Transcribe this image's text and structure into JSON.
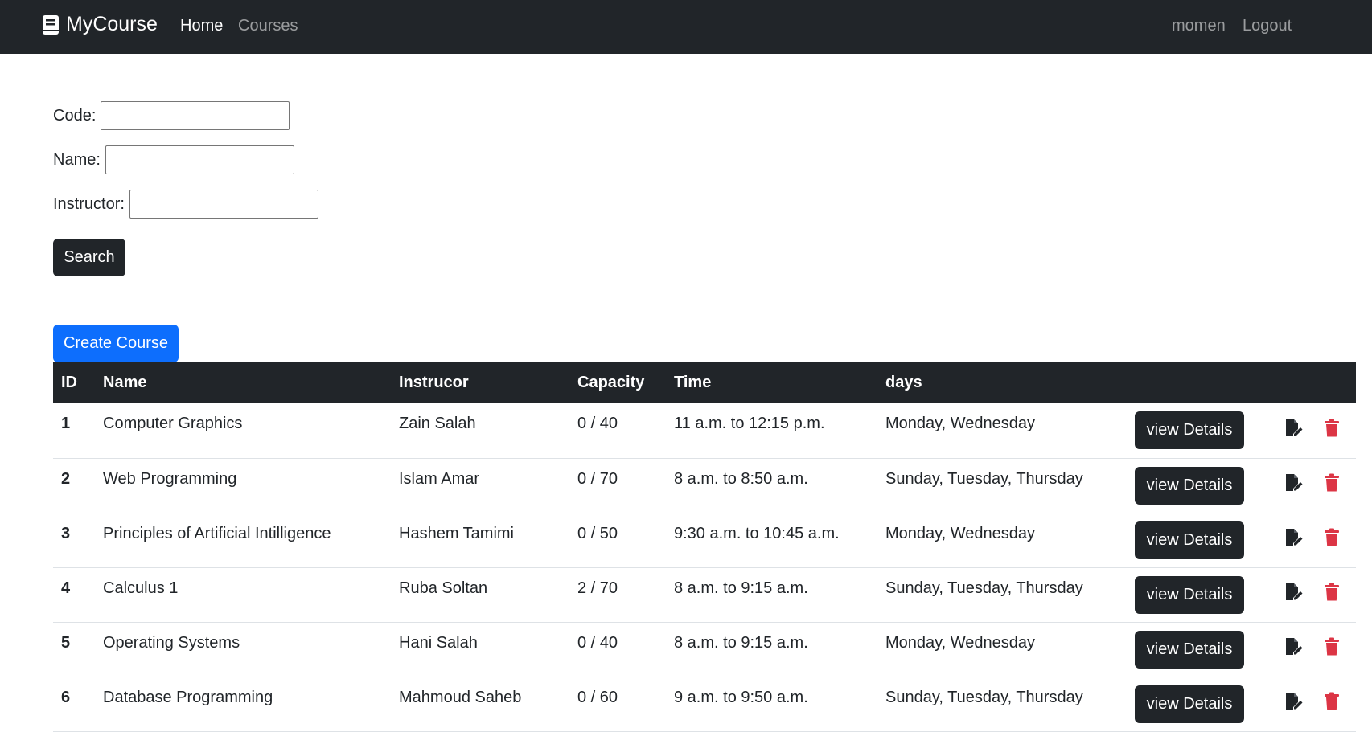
{
  "navbar": {
    "brand": "MyCourse",
    "links": [
      {
        "label": "Home",
        "active": true
      },
      {
        "label": "Courses",
        "active": false
      }
    ],
    "user": "momen",
    "logout": "Logout"
  },
  "search_form": {
    "code_label": "Code:",
    "code_value": "",
    "name_label": "Name:",
    "name_value": "",
    "instructor_label": "Instructor:",
    "instructor_value": "",
    "search_button": "Search"
  },
  "create_button": "Create Course",
  "table": {
    "headers": [
      "ID",
      "Name",
      "Instrucor",
      "Capacity",
      "Time",
      "days"
    ],
    "view_label": "view Details",
    "rows": [
      {
        "id": "1",
        "name": "Computer Graphics",
        "instructor": "Zain Salah",
        "capacity": "0 / 40",
        "time": "11 a.m. to 12:15 p.m.",
        "days": "Monday, Wednesday"
      },
      {
        "id": "2",
        "name": "Web Programming",
        "instructor": "Islam Amar",
        "capacity": "0 / 70",
        "time": "8 a.m. to 8:50 a.m.",
        "days": "Sunday, Tuesday, Thursday"
      },
      {
        "id": "3",
        "name": "Principles of Artificial Intilligence",
        "instructor": "Hashem Tamimi",
        "capacity": "0 / 50",
        "time": "9:30 a.m. to 10:45 a.m.",
        "days": "Monday, Wednesday"
      },
      {
        "id": "4",
        "name": "Calculus 1",
        "instructor": "Ruba Soltan",
        "capacity": "2 / 70",
        "time": "8 a.m. to 9:15 a.m.",
        "days": "Sunday, Tuesday, Thursday"
      },
      {
        "id": "5",
        "name": "Operating Systems",
        "instructor": "Hani Salah",
        "capacity": "0 / 40",
        "time": "8 a.m. to 9:15 a.m.",
        "days": "Monday, Wednesday"
      },
      {
        "id": "6",
        "name": "Database Programming",
        "instructor": "Mahmoud Saheb",
        "capacity": "0 / 60",
        "time": "9 a.m. to 9:50 a.m.",
        "days": "Sunday, Tuesday, Thursday"
      }
    ]
  },
  "icons": {
    "edit": "edit-file-icon",
    "delete": "trash-icon",
    "brand": "book-icon"
  },
  "colors": {
    "navbar": "#212529",
    "primary": "#0d6efd",
    "delete": "#dc3545",
    "edit": "#212529"
  }
}
